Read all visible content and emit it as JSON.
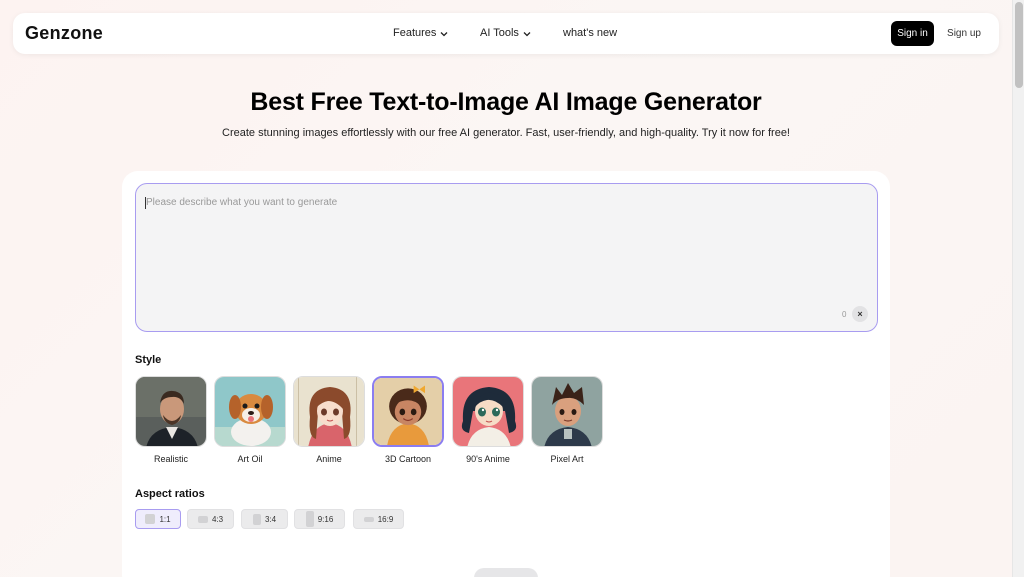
{
  "header": {
    "logo": "Genzone",
    "nav": [
      {
        "label": "Features",
        "has_dropdown": true
      },
      {
        "label": "AI Tools",
        "has_dropdown": true
      },
      {
        "label": "what's new",
        "has_dropdown": false
      }
    ],
    "sign_in": "Sign in",
    "sign_up": "Sign up"
  },
  "hero": {
    "title": "Best Free Text-to-Image AI Image Generator",
    "subtitle": "Create stunning images effortlessly with our free AI generator. Fast, user-friendly, and high-quality. Try it now for free!"
  },
  "prompt": {
    "placeholder": "Please describe what you want to generate",
    "char_count": "0",
    "clear_icon": "close-icon"
  },
  "style_section": {
    "label": "Style",
    "selected": "3D Cartoon",
    "items": [
      {
        "label": "Realistic"
      },
      {
        "label": "Art Oil"
      },
      {
        "label": "Anime"
      },
      {
        "label": "3D Cartoon"
      },
      {
        "label": "90's Anime"
      },
      {
        "label": "Pixel Art"
      }
    ]
  },
  "aspect_section": {
    "label": "Aspect ratios",
    "selected": "1:1",
    "items": [
      {
        "label": "1:1"
      },
      {
        "label": "4:3"
      },
      {
        "label": "3:4"
      },
      {
        "label": "9:16"
      },
      {
        "label": "16:9"
      }
    ]
  },
  "colors": {
    "accent": "#8b7df0",
    "primary_button": "#000000"
  }
}
